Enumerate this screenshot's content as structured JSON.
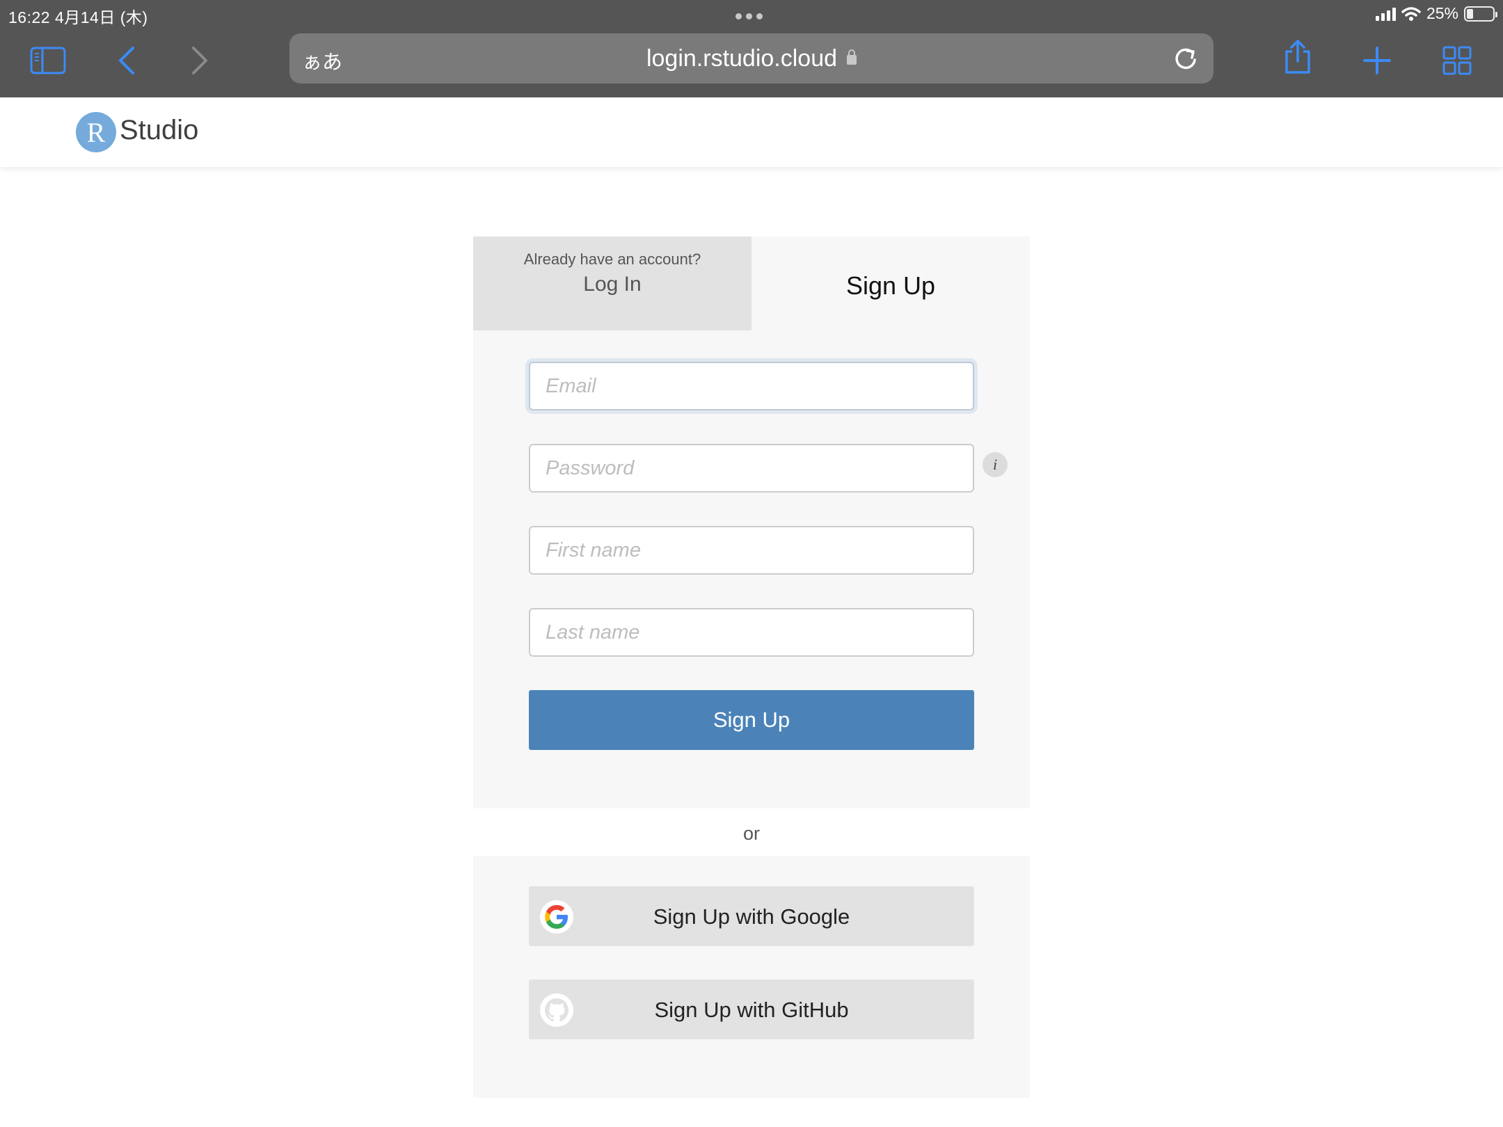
{
  "status_bar": {
    "time_date": "16:22   4月14日 (木)",
    "battery": "25%",
    "battery_fraction": 0.25
  },
  "browser": {
    "aa_label": "ぁあ",
    "url": "login.rstudio.cloud",
    "icons": [
      "sidebar-icon",
      "back-icon",
      "forward-icon",
      "lock-icon",
      "reload-icon",
      "share-icon",
      "new-tab-icon",
      "tabs-icon"
    ]
  },
  "header": {
    "logo_letter": "R",
    "logo_text": "Studio"
  },
  "auth": {
    "login_tab_pre": "Already have an account?",
    "login_tab_label": "Log In",
    "signup_tab_label": "Sign Up",
    "fields": {
      "email_placeholder": "Email",
      "password_placeholder": "Password",
      "first_name_placeholder": "First name",
      "last_name_placeholder": "Last name"
    },
    "password_info_glyph": "i",
    "submit_label": "Sign Up",
    "or_label": "or",
    "google_label": "Sign Up with Google",
    "github_label": "Sign Up with GitHub"
  },
  "colors": {
    "chrome_bg": "#555555",
    "accent_blue": "#3c8bf7",
    "logo_blue": "#75aadb",
    "primary_button": "#4b83b9"
  }
}
